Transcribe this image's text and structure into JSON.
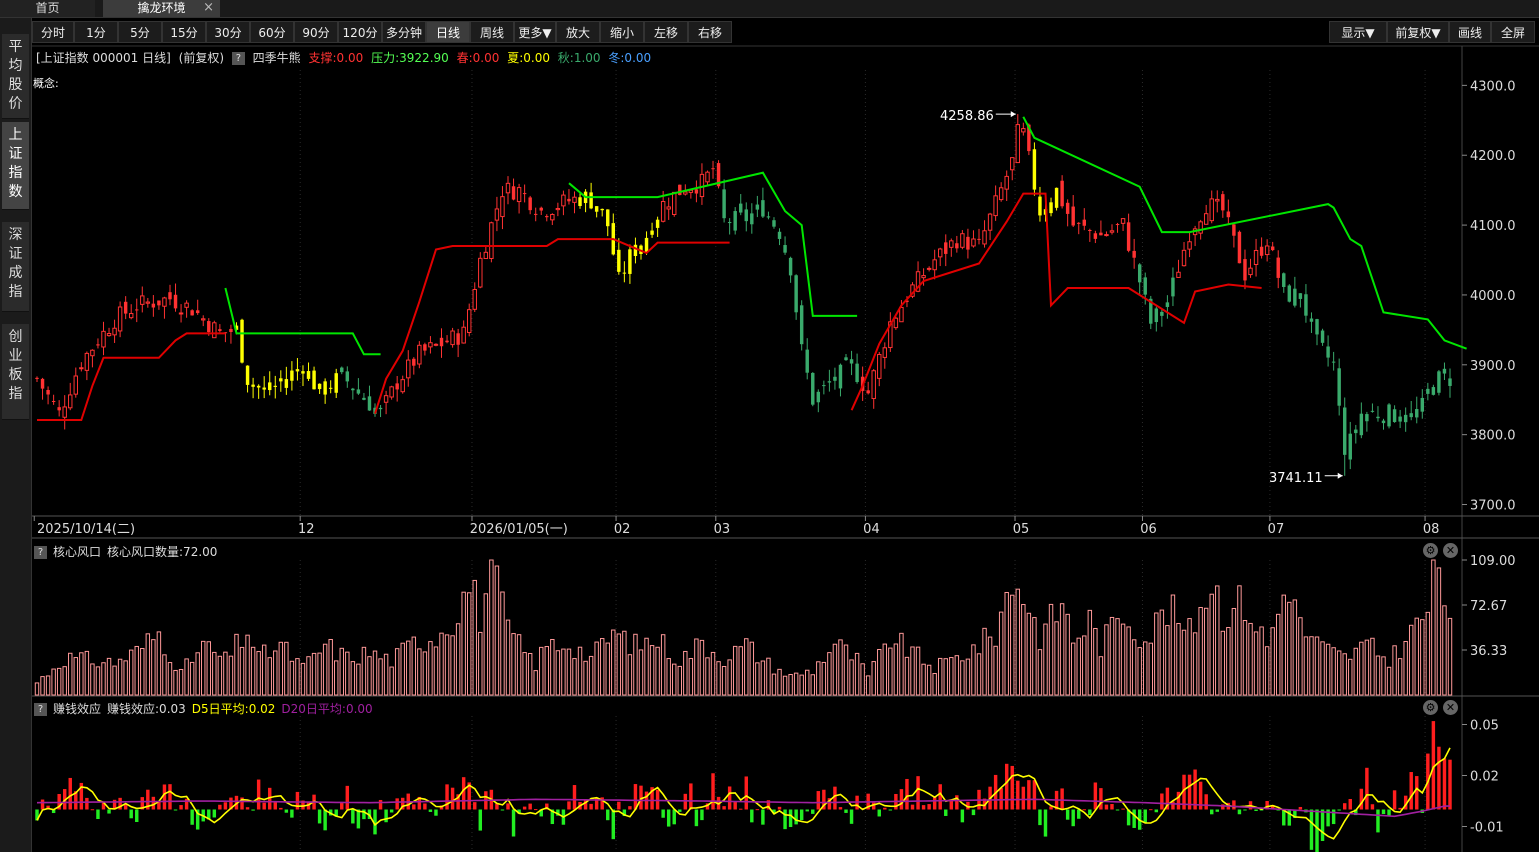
{
  "tabs": {
    "home": "首页",
    "active": "擒龙环境",
    "close": "×"
  },
  "sidebar": [
    {
      "label": "平均股价",
      "active": false
    },
    {
      "label": "上证指数",
      "active": true
    },
    {
      "label": "深证成指",
      "active": false
    },
    {
      "label": "创业板指",
      "active": false
    }
  ],
  "toolbar": {
    "left": [
      "分时",
      "1分",
      "5分",
      "15分",
      "30分",
      "60分",
      "90分",
      "120分",
      "多分钟",
      "日线",
      "周线",
      "更多▼",
      "放大",
      "缩小",
      "左移",
      "右移"
    ],
    "active": "日线",
    "right": [
      "显示▼",
      "前复权▼",
      "画线",
      "全屏"
    ]
  },
  "info": {
    "index_name": "[上证指数 000001 日线]",
    "adjust": "(前复权)",
    "help": "?",
    "indicator_name": "四季牛熊",
    "support": "支撑:0.00",
    "pressure": "压力:3922.90",
    "spring": "春:0.00",
    "summer": "夏:0.00",
    "autumn": "秋:1.00",
    "winter": "冬:0.00",
    "concept": "概念:"
  },
  "colors": {
    "up": "#ff3232",
    "down": "#54ff54",
    "yellow": "#ffff00",
    "teal": "#3aaa6c",
    "pink": "#ff9999",
    "green": "#00e600",
    "purple": "#a020a0"
  },
  "panel1": {
    "title": "核心风口",
    "value_label": "核心风口数量:72.00"
  },
  "panel2": {
    "title": "赚钱效应",
    "value_label": "赚钱效应:0.03",
    "d5": "D5日平均:0.02",
    "d20": "D20日平均:0.00"
  },
  "chart_data": [
    {
      "type": "candlestick",
      "title": "上证指数 000001 日线",
      "y_ticks": [
        3700.0,
        3800.0,
        3900.0,
        4000.0,
        4100.0,
        4200.0,
        4300.0
      ],
      "y_tick_labels": [
        "3700.0",
        "3800.0",
        "3900.0",
        "4000.0",
        "4100.0",
        "4200.0",
        "4300.0"
      ],
      "ylim": [
        3685,
        4322
      ],
      "x_labels": [
        "2025/10/14(二)",
        "12",
        "2026/01/05(一)",
        "02",
        "03",
        "04",
        "05",
        "06",
        "07",
        "08"
      ],
      "x_label_index": [
        0,
        48,
        79,
        105,
        123,
        150,
        177,
        200,
        223,
        251
      ],
      "max_label": "4258.86",
      "max_index": 177,
      "max_value": 4258.86,
      "min_label": "3741.11",
      "min_index": 236,
      "min_value": 3741.11,
      "keypoints": [
        [
          0,
          3880
        ],
        [
          4,
          3830
        ],
        [
          8,
          3905
        ],
        [
          14,
          3965
        ],
        [
          18,
          3985
        ],
        [
          24,
          3995
        ],
        [
          28,
          3980
        ],
        [
          33,
          3945
        ],
        [
          36,
          3950
        ],
        [
          38,
          3880
        ],
        [
          41,
          3860
        ],
        [
          44,
          3875
        ],
        [
          48,
          3900
        ],
        [
          51,
          3860
        ],
        [
          55,
          3885
        ],
        [
          58,
          3860
        ],
        [
          62,
          3830
        ],
        [
          65,
          3875
        ],
        [
          69,
          3915
        ],
        [
          73,
          3930
        ],
        [
          77,
          3945
        ],
        [
          80,
          4050
        ],
        [
          84,
          4150
        ],
        [
          87,
          4150
        ],
        [
          91,
          4120
        ],
        [
          96,
          4135
        ],
        [
          99,
          4140
        ],
        [
          101,
          4130
        ],
        [
          103,
          4100
        ],
        [
          105,
          4020
        ],
        [
          107,
          4055
        ],
        [
          110,
          4085
        ],
        [
          113,
          4130
        ],
        [
          117,
          4155
        ],
        [
          120,
          4160
        ],
        [
          122,
          4180
        ],
        [
          124,
          4105
        ],
        [
          128,
          4110
        ],
        [
          131,
          4125
        ],
        [
          134,
          4090
        ],
        [
          136,
          4040
        ],
        [
          138,
          3920
        ],
        [
          140,
          3850
        ],
        [
          144,
          3880
        ],
        [
          147,
          3900
        ],
        [
          150,
          3860
        ],
        [
          154,
          3960
        ],
        [
          158,
          4010
        ],
        [
          162,
          4050
        ],
        [
          166,
          4080
        ],
        [
          170,
          4070
        ],
        [
          174,
          4150
        ],
        [
          178,
          4230
        ],
        [
          181,
          4120
        ],
        [
          184,
          4150
        ],
        [
          187,
          4100
        ],
        [
          192,
          4085
        ],
        [
          196,
          4100
        ],
        [
          199,
          4020
        ],
        [
          201,
          3960
        ],
        [
          204,
          3990
        ],
        [
          208,
          4090
        ],
        [
          211,
          4130
        ],
        [
          214,
          4120
        ],
        [
          218,
          4030
        ],
        [
          222,
          4080
        ],
        [
          225,
          4000
        ],
        [
          228,
          4000
        ],
        [
          231,
          3930
        ],
        [
          234,
          3900
        ],
        [
          236,
          3770
        ],
        [
          239,
          3830
        ],
        [
          244,
          3830
        ],
        [
          248,
          3825
        ],
        [
          250,
          3840
        ],
        [
          252,
          3880
        ]
      ],
      "support_line": [
        [
          0,
          3821
        ],
        [
          8,
          3821
        ],
        [
          10,
          3870
        ],
        [
          12,
          3910
        ],
        [
          22,
          3910
        ],
        [
          25,
          3935
        ],
        [
          27,
          3945
        ],
        [
          34,
          3945
        ],
        [
          61,
          3830
        ],
        [
          63,
          3880
        ],
        [
          66,
          3920
        ],
        [
          69,
          3990
        ],
        [
          72,
          4065
        ],
        [
          75,
          4070
        ],
        [
          86,
          4070
        ],
        [
          92,
          4070
        ],
        [
          94,
          4080
        ],
        [
          104,
          4080
        ],
        [
          110,
          4060
        ],
        [
          112,
          4075
        ],
        [
          125,
          4075
        ],
        [
          147,
          3835
        ],
        [
          149,
          3870
        ],
        [
          152,
          3930
        ],
        [
          156,
          3985
        ],
        [
          160,
          4020
        ],
        [
          170,
          4045
        ],
        [
          175,
          4105
        ],
        [
          178,
          4145
        ],
        [
          182,
          4145
        ],
        [
          183,
          3985
        ],
        [
          186,
          4010
        ],
        [
          197,
          4010
        ],
        [
          207,
          3960
        ],
        [
          209,
          4005
        ],
        [
          215,
          4015
        ],
        [
          221,
          4010
        ]
      ],
      "pressure_line": [
        [
          34,
          4010
        ],
        [
          36,
          3945
        ],
        [
          57,
          3945
        ],
        [
          59,
          3915
        ],
        [
          62,
          3915
        ],
        [
          96,
          4160
        ],
        [
          99,
          4140
        ],
        [
          112,
          4140
        ],
        [
          131,
          4175
        ],
        [
          135,
          4120
        ],
        [
          138,
          4100
        ],
        [
          140,
          3970
        ],
        [
          148,
          3970
        ],
        [
          178,
          4255
        ],
        [
          180,
          4225
        ],
        [
          199,
          4155
        ],
        [
          203,
          4090
        ],
        [
          208,
          4090
        ],
        [
          233,
          4130
        ],
        [
          234,
          4125
        ],
        [
          237,
          4080
        ],
        [
          239,
          4070
        ],
        [
          243,
          3975
        ],
        [
          251,
          3965
        ],
        [
          254,
          3935
        ],
        [
          258,
          3923
        ]
      ],
      "green_candle_range": [
        [
          55,
          62
        ],
        [
          124,
          148
        ],
        [
          199,
          205
        ],
        [
          225,
          259
        ]
      ],
      "yellow_candle_range": [
        [
          36,
          56
        ],
        [
          98,
          112
        ],
        [
          180,
          184
        ],
        [
          200,
          201
        ]
      ]
    },
    {
      "type": "bar",
      "title": "核心风口",
      "series_label": "核心风口数量",
      "y_ticks": [
        36.33,
        72.67,
        109.0
      ],
      "y_tick_labels": [
        "36.33",
        "72.67",
        "109.00"
      ],
      "ylim": [
        0,
        109
      ],
      "last_value": 72.0,
      "keypoints": [
        [
          0,
          10
        ],
        [
          5,
          30
        ],
        [
          10,
          28
        ],
        [
          14,
          26
        ],
        [
          18,
          35
        ],
        [
          22,
          50
        ],
        [
          26,
          18
        ],
        [
          30,
          40
        ],
        [
          34,
          28
        ],
        [
          38,
          52
        ],
        [
          40,
          30
        ],
        [
          44,
          40
        ],
        [
          48,
          22
        ],
        [
          52,
          40
        ],
        [
          56,
          30
        ],
        [
          60,
          34
        ],
        [
          64,
          28
        ],
        [
          68,
          42
        ],
        [
          72,
          48
        ],
        [
          76,
          68
        ],
        [
          78,
          90
        ],
        [
          80,
          65
        ],
        [
          82,
          100
        ],
        [
          84,
          70
        ],
        [
          86,
          45
        ],
        [
          88,
          35
        ],
        [
          90,
          25
        ],
        [
          92,
          40
        ],
        [
          96,
          42
        ],
        [
          100,
          30
        ],
        [
          104,
          50
        ],
        [
          108,
          40
        ],
        [
          112,
          45
        ],
        [
          116,
          28
        ],
        [
          120,
          42
        ],
        [
          124,
          30
        ],
        [
          128,
          40
        ],
        [
          132,
          25
        ],
        [
          136,
          15
        ],
        [
          140,
          20
        ],
        [
          144,
          42
        ],
        [
          148,
          28
        ],
        [
          150,
          15
        ],
        [
          154,
          46
        ],
        [
          158,
          34
        ],
        [
          162,
          22
        ],
        [
          166,
          30
        ],
        [
          170,
          40
        ],
        [
          173,
          50
        ],
        [
          175,
          80
        ],
        [
          177,
          95
        ],
        [
          179,
          70
        ],
        [
          181,
          48
        ],
        [
          183,
          60
        ],
        [
          185,
          75
        ],
        [
          187,
          45
        ],
        [
          190,
          60
        ],
        [
          192,
          40
        ],
        [
          196,
          68
        ],
        [
          200,
          45
        ],
        [
          204,
          70
        ],
        [
          208,
          50
        ],
        [
          212,
          95
        ],
        [
          214,
          68
        ],
        [
          218,
          75
        ],
        [
          222,
          40
        ],
        [
          226,
          95
        ],
        [
          228,
          55
        ],
        [
          232,
          38
        ],
        [
          236,
          30
        ],
        [
          240,
          40
        ],
        [
          244,
          28
        ],
        [
          248,
          50
        ],
        [
          251,
          70
        ],
        [
          253,
          105
        ],
        [
          254,
          72
        ]
      ]
    },
    {
      "type": "bar+line",
      "title": "赚钱效应",
      "series": [
        {
          "name": "赚钱效应",
          "last": 0.03
        },
        {
          "name": "D5日平均",
          "last": 0.02
        },
        {
          "name": "D20日平均",
          "last": 0.0
        }
      ],
      "y_ticks": [
        -0.01,
        0.02,
        0.05
      ],
      "y_tick_labels": [
        "-0.01",
        "0.02",
        "0.05"
      ],
      "ylim": [
        -0.025,
        0.055
      ],
      "keypoints": [
        [
          0,
          0.002
        ],
        [
          3,
          -0.004
        ],
        [
          5,
          0.018
        ],
        [
          8,
          0.008
        ],
        [
          10,
          -0.006
        ],
        [
          12,
          0.008
        ],
        [
          14,
          0.006
        ],
        [
          18,
          -0.002
        ],
        [
          22,
          0.011
        ],
        [
          26,
          0.006
        ],
        [
          30,
          -0.005
        ],
        [
          34,
          0.006
        ],
        [
          36,
          0.012
        ],
        [
          38,
          -0.007
        ],
        [
          40,
          0.014
        ],
        [
          44,
          -0.003
        ],
        [
          48,
          0.007
        ],
        [
          52,
          -0.006
        ],
        [
          56,
          0.006
        ],
        [
          60,
          -0.012
        ],
        [
          64,
          0.004
        ],
        [
          66,
          0.01
        ],
        [
          70,
          -0.004
        ],
        [
          74,
          0.009
        ],
        [
          78,
          0.012
        ],
        [
          80,
          -0.006
        ],
        [
          82,
          0.018
        ],
        [
          84,
          0.006
        ],
        [
          86,
          -0.006
        ],
        [
          90,
          0.01
        ],
        [
          94,
          -0.007
        ],
        [
          96,
          0.005
        ],
        [
          100,
          0.012
        ],
        [
          104,
          -0.016
        ],
        [
          106,
          0.006
        ],
        [
          110,
          0.014
        ],
        [
          114,
          -0.004
        ],
        [
          118,
          0.008
        ],
        [
          120,
          -0.009
        ],
        [
          122,
          0.016
        ],
        [
          124,
          0.003
        ],
        [
          128,
          0.01
        ],
        [
          130,
          -0.008
        ],
        [
          134,
          0.006
        ],
        [
          136,
          -0.012
        ],
        [
          138,
          -0.001
        ],
        [
          140,
          0.007
        ],
        [
          144,
          0.004
        ],
        [
          147,
          -0.006
        ],
        [
          150,
          0.012
        ],
        [
          152,
          0.003
        ],
        [
          156,
          0.007
        ],
        [
          160,
          0.011
        ],
        [
          164,
          0.006
        ],
        [
          168,
          -0.002
        ],
        [
          172,
          0.008
        ],
        [
          176,
          0.03
        ],
        [
          178,
          0.018
        ],
        [
          180,
          0.01
        ],
        [
          182,
          -0.014
        ],
        [
          184,
          0.008
        ],
        [
          188,
          -0.008
        ],
        [
          192,
          0.012
        ],
        [
          196,
          0.003
        ],
        [
          200,
          -0.012
        ],
        [
          204,
          0.013
        ],
        [
          208,
          0.018
        ],
        [
          212,
          0.003
        ],
        [
          216,
          0.007
        ],
        [
          218,
          -0.009
        ],
        [
          220,
          0.008
        ],
        [
          224,
          -0.006
        ],
        [
          226,
          -0.018
        ],
        [
          228,
          -0.008
        ],
        [
          231,
          -0.018
        ],
        [
          234,
          -0.01
        ],
        [
          236,
          0.012
        ],
        [
          238,
          -0.006
        ],
        [
          240,
          0.018
        ],
        [
          242,
          -0.008
        ],
        [
          244,
          0.003
        ],
        [
          248,
          0.016
        ],
        [
          250,
          0.004
        ],
        [
          252,
          0.05
        ],
        [
          254,
          0.03
        ]
      ],
      "d20_keypoints": [
        [
          0,
          0.004
        ],
        [
          30,
          0.005
        ],
        [
          60,
          0.004
        ],
        [
          90,
          0.006
        ],
        [
          120,
          0.005
        ],
        [
          140,
          0.004
        ],
        [
          160,
          0.005
        ],
        [
          180,
          0.006
        ],
        [
          200,
          0.004
        ],
        [
          215,
          0.002
        ],
        [
          225,
          0.0
        ],
        [
          235,
          -0.002
        ],
        [
          245,
          -0.004
        ],
        [
          250,
          -0.001
        ],
        [
          254,
          0.002
        ]
      ]
    }
  ]
}
